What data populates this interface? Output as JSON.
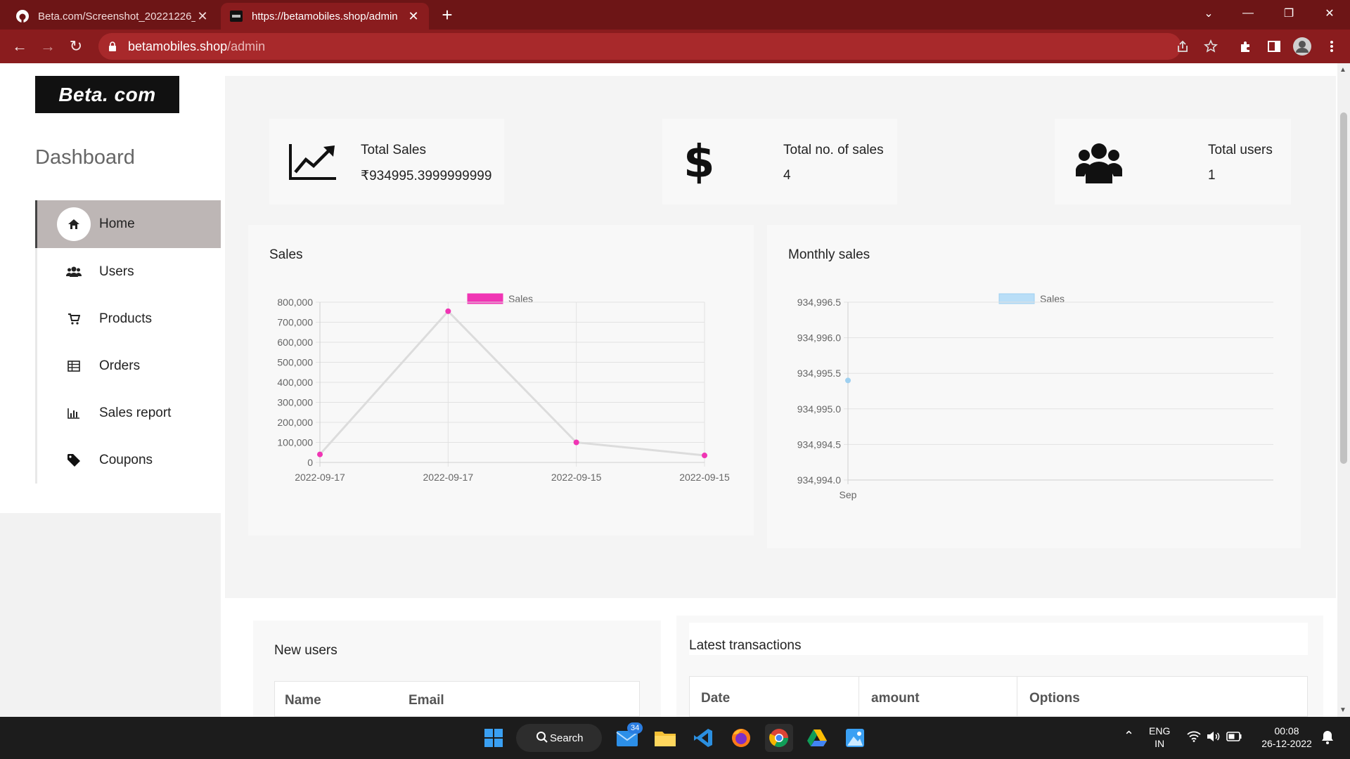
{
  "browser": {
    "tabs": [
      {
        "title": "Beta.com/Screenshot_20221226_",
        "active": false
      },
      {
        "title": "https://betamobiles.shop/admin",
        "active": true
      }
    ],
    "url_host": "betamobiles.shop",
    "url_path": "/admin"
  },
  "sidebar": {
    "logo": "Beta. com",
    "title": "Dashboard",
    "items": [
      {
        "label": "Home",
        "icon": "home-icon",
        "active": true
      },
      {
        "label": "Users",
        "icon": "users-icon",
        "active": false
      },
      {
        "label": "Products",
        "icon": "cart-icon",
        "active": false
      },
      {
        "label": "Orders",
        "icon": "table-icon",
        "active": false
      },
      {
        "label": "Sales report",
        "icon": "bar-chart-icon",
        "active": false
      },
      {
        "label": "Coupons",
        "icon": "tag-icon",
        "active": false
      }
    ]
  },
  "stats": {
    "total_sales_label": "Total Sales",
    "total_sales_value": "₹934995.3999999999",
    "total_no_sales_label": "Total no. of sales",
    "total_no_sales_value": "4",
    "total_users_label": "Total users",
    "total_users_value": "1"
  },
  "chart_data": [
    {
      "type": "line",
      "title": "Sales",
      "x": [
        "2022-09-17",
        "2022-09-17",
        "2022-09-15",
        "2022-09-15"
      ],
      "series": [
        {
          "name": "Sales",
          "values": [
            40000,
            755000,
            100000,
            35000
          ],
          "color": "#f035b4"
        }
      ],
      "ylim": [
        0,
        800000
      ],
      "yticks": [
        "800,000",
        "700,000",
        "600,000",
        "500,000",
        "400,000",
        "300,000",
        "200,000",
        "100,000",
        "0"
      ],
      "legend": "top-center",
      "grid": true
    },
    {
      "type": "line",
      "title": "Monthly sales",
      "x": [
        "Sep"
      ],
      "series": [
        {
          "name": "Sales",
          "values": [
            934995.4
          ],
          "color": "#9fd0f0"
        }
      ],
      "ylim": [
        934994.0,
        934996.5
      ],
      "yticks": [
        "934,996.5",
        "934,996.0",
        "934,995.5",
        "934,995.0",
        "934,994.5",
        "934,994.0"
      ],
      "legend": "top-center",
      "grid": true
    }
  ],
  "new_users": {
    "title": "New users",
    "columns": [
      "Name",
      "Email"
    ]
  },
  "transactions": {
    "title": "Latest transactions",
    "columns": [
      "Date",
      "amount",
      "Options"
    ]
  },
  "taskbar": {
    "search_label": "Search",
    "mail_badge": "34",
    "lang": "ENG",
    "region": "IN",
    "time": "00:08",
    "date": "26-12-2022"
  }
}
